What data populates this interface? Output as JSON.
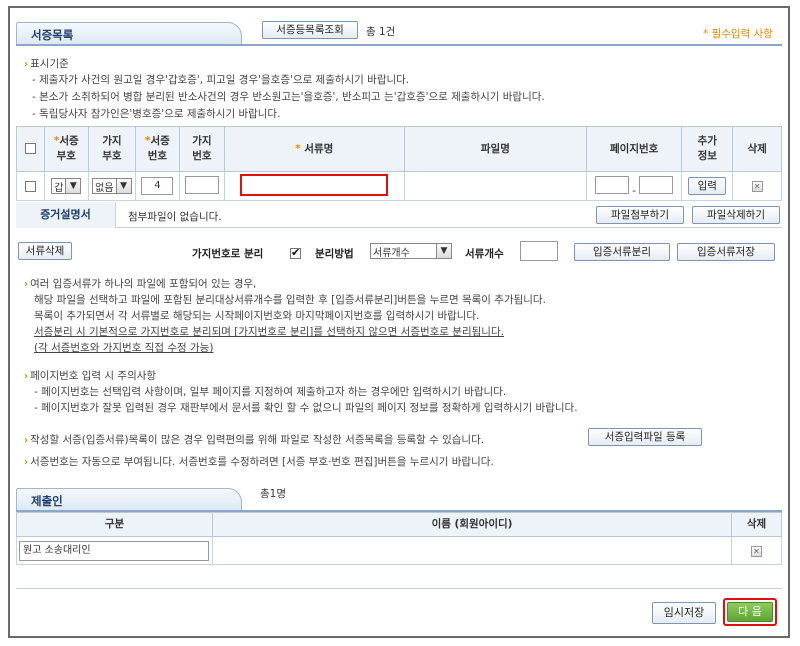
{
  "evidence_list": {
    "tab_title": "서증목록",
    "lookup_button": "서증등목록조회",
    "total_count": "총 1건",
    "required_note": "* 필수입력 사항",
    "criteria": {
      "title": "표시기준",
      "lines": [
        "- 제출자가 사건의 원고일 경우'갑호증', 피고일 경우'을호증'으로 제출하시기 바랍니다.",
        "- 본소가 소취하되어 병합 분리된 반소사건의 경우 반소원고는'을호증', 반소피고 는'갑호증'으로 제출하시기 바랍니다.",
        "- 독립당사자 참가인은'병호증'으로 제출하시기 바랍니다."
      ]
    },
    "table": {
      "headers": {
        "prefix_star": "*",
        "prefix_top": "서증",
        "prefix_bottom": "부호",
        "branch_top": "가지",
        "branch_bottom": "부호",
        "num_star": "*",
        "num_top": "서증",
        "num_bottom": "번호",
        "branchnum_top": "가지",
        "branchnum_bottom": "번호",
        "docname_star": "*",
        "docname": "서류명",
        "filename": "파일명",
        "page": "페이지번호",
        "extra_top": "추가",
        "extra_bottom": "정보",
        "delete": "삭제"
      },
      "row": {
        "prefix_value": "갑",
        "branch_value": "없음",
        "num_value": "4",
        "page_dash": "-",
        "input_button": "입력"
      }
    },
    "explain_label": "증거설명서",
    "no_attachment": "첨부파일이 없습니다.",
    "attach_button": "파일첨부하기",
    "delete_file_button": "파일삭제하기"
  },
  "split_bar": {
    "delete_doc_button": "서류삭제",
    "branch_split_label": "가지번호로 분리",
    "split_method_label": "분리방법",
    "split_method_value": "서류개수",
    "doc_count_label": "서류개수",
    "split_button": "입증서류분리",
    "save_button": "입증서류저장"
  },
  "notes1": [
    "여러 입증서류가 하나의 파일에 포함되어 있는 경우,",
    "해당 파일을 선택하고 파일에 포함된 분리대상서류개수를 입력한 후 [입증서류분리]버튼을 누르면 목록이 추가됩니다.",
    "목록이 추가되면서 각 서류별로 해당되는 시작페이지번호와 마지막페이지번호를 입력하시기 바랍니다.",
    "서증분리 시 기본적으로 가지번호로 분리되며 [가지번호로 분리]를 선택하지 않으면 서증번호로 분리됩니다.",
    "(각 서증번호와 가지번호 직접 수정 가능)"
  ],
  "notes2": {
    "title": "페이지번호 입력 시 주의사항",
    "lines": [
      "- 페이지번호는 선택입력 사항이며, 일부 페이지를 지정하여 제출하고자 하는 경우에만 입력하시기 바랍니다.",
      "- 페이지번호가 잘못 입력된 경우 재판부에서 문서를 확인 할 수 없으니 파일의 페이지 정보를 정확하게 입력하시기 바랍니다."
    ]
  },
  "note3": "작성할 서증(입증서류)목록이 많은 경우 입력편의를 위해 파일로 작성한 서증목록을 등록할 수 있습니다.",
  "register_file_button": "서증입력파일 등록",
  "note4": "서증번호는 자동으로 부여됩니다. 서증번호를 수정하려면 [서증 부호·번호 편집]버튼을 누르시기 바랍니다.",
  "submitter": {
    "tab_title": "제출인",
    "count": "총1명",
    "headers": {
      "type": "구분",
      "name": "이름 (회원아이디)",
      "delete": "삭제"
    },
    "row": {
      "type_value": "원고 소송대리인"
    }
  },
  "footer": {
    "temp_save_button": "임시저장",
    "next_button": "다 음"
  },
  "colors": {
    "accent": "#1f3f73",
    "required": "#e08a00",
    "highlight_red": "#e01010",
    "next_green": "#6cb33f"
  }
}
